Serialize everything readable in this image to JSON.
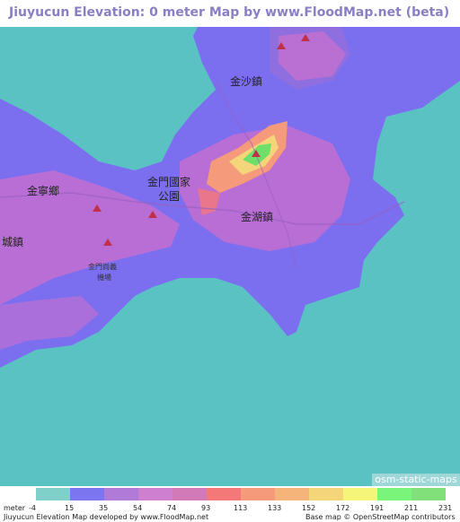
{
  "title": "Jiuyucun Elevation: 0 meter Map by www.FloodMap.net (beta)",
  "map": {
    "places": [
      {
        "id": "jinsha",
        "label": "金沙鎮"
      },
      {
        "id": "jinning",
        "label": "金寧鄉"
      },
      {
        "id": "park1",
        "label": "金門國家"
      },
      {
        "id": "park2",
        "label": "公園"
      },
      {
        "id": "jinhu",
        "label": "金湖鎮"
      },
      {
        "id": "jincheng",
        "label": "城鎮"
      },
      {
        "id": "airport1",
        "label": "金門尚義"
      },
      {
        "id": "airport2",
        "label": "機場"
      }
    ],
    "osm_label": "osm-static-maps",
    "colors": {
      "water": "#5bc2c4",
      "lowland": "#7b6ff0",
      "mid": "#c46fd0",
      "high": "#f5a56a",
      "peak": "#6ee06a"
    }
  },
  "legend": {
    "unit": "meter",
    "ticks": [
      "-4",
      "15",
      "35",
      "54",
      "74",
      "93",
      "113",
      "133",
      "152",
      "172",
      "191",
      "211",
      "231"
    ],
    "colors": [
      "#7fd0c8",
      "#7b76f0",
      "#b07ad8",
      "#cf7fd0",
      "#d27ab8",
      "#f57878",
      "#f59a7a",
      "#f5b57a",
      "#f5d57a",
      "#f5f57a",
      "#7af57a",
      "#82e07a"
    ],
    "credit_left": "Jiuyucun Elevation Map developed by www.FloodMap.net",
    "credit_right": "Base map © OpenStreetMap contributors"
  }
}
